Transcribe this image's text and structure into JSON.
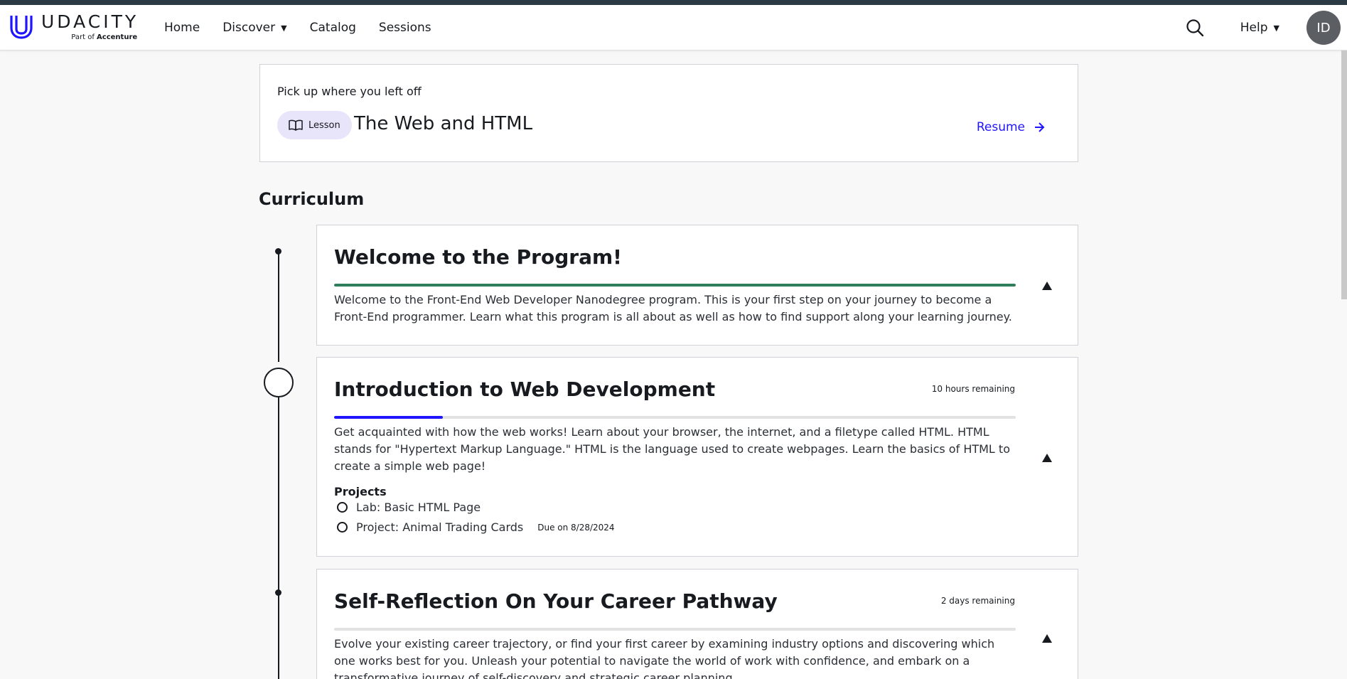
{
  "brand": {
    "name": "UDACITY",
    "sub_prefix": "Part of",
    "sub_name": "Accenture",
    "color": "#2015ff"
  },
  "nav": {
    "items": [
      {
        "label": "Home"
      },
      {
        "label": "Discover"
      },
      {
        "label": "Catalog"
      },
      {
        "label": "Sessions"
      }
    ],
    "help_label": "Help",
    "avatar_initials": "ID",
    "search_icon": "search-icon"
  },
  "resume": {
    "heading": "Pick up where you left off",
    "pill_label": "Lesson",
    "lesson_title": "The Web and HTML",
    "button_label": "Resume"
  },
  "curriculum": {
    "heading": "Curriculum",
    "lessons": [
      {
        "title": "Welcome to the Program!",
        "remaining": "",
        "progress": 1.0,
        "progress_color": "#2e7d5b",
        "description": "Welcome to the Front-End Web Developer Nanodegree program. This is your first step on your journey to become a Front-End programmer. Learn what this program is all about as well as how to find support along your learning journey."
      },
      {
        "title": "Introduction to Web Development",
        "remaining": "10 hours remaining",
        "progress": 0.16,
        "progress_color": "#2015ff",
        "description": "Get acquainted with how the web works! Learn about your browser, the internet, and a filetype called HTML. HTML stands for \"Hypertext Markup Language.\" HTML is the language used to create webpages. Learn the basics of HTML to create a simple web page!",
        "projects_label": "Projects",
        "projects": [
          {
            "name": "Lab: Basic HTML Page",
            "due": ""
          },
          {
            "name": "Project: Animal Trading Cards",
            "due": "Due on 8/28/2024"
          }
        ]
      },
      {
        "title": "Self-Reflection On Your Career Pathway",
        "remaining": "2 days remaining",
        "progress": 0.0,
        "progress_color": "#2015ff",
        "description": "Evolve your existing career trajectory, or find your first career by examining industry options and discovering which one works best for you. Unleash your potential to navigate the world of work with confidence, and embark on a transformative journey of self-discovery and strategic career planning."
      }
    ]
  }
}
